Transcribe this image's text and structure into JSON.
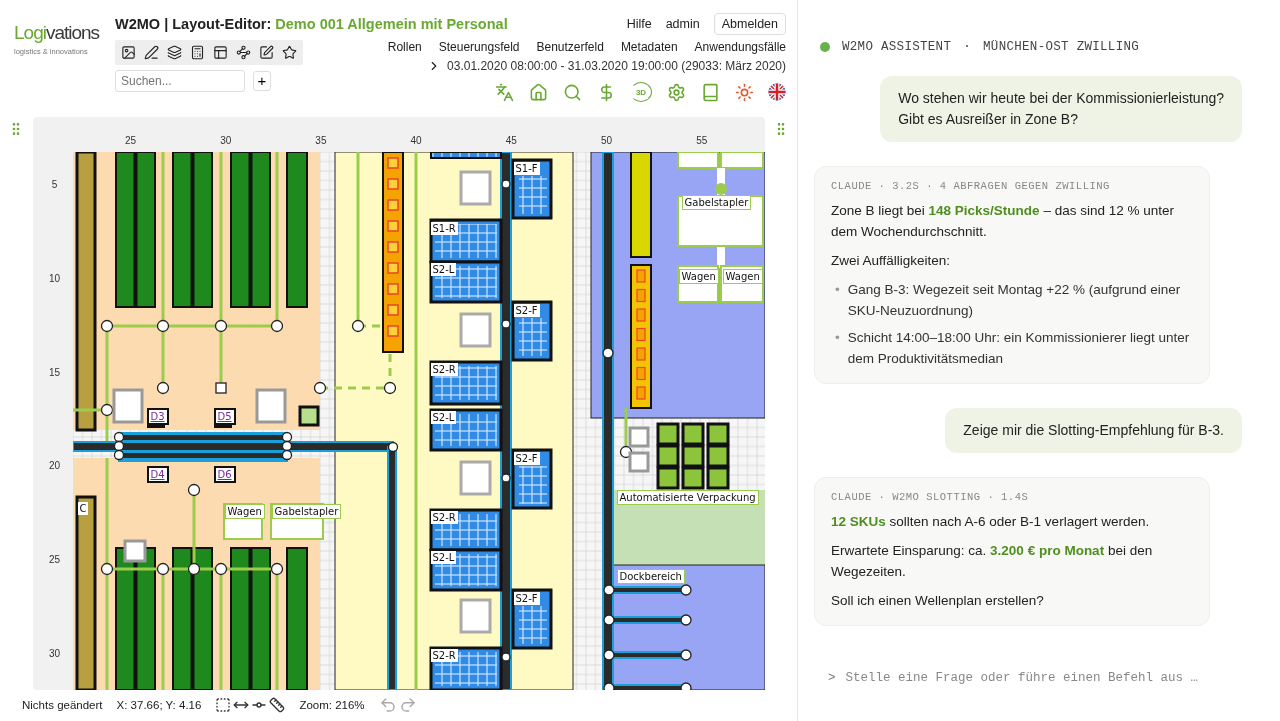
{
  "brand": {
    "name": "**Logi**vations",
    "tagline": "logistics & innovations"
  },
  "header": {
    "title": "W2MO | Layout-Editor: **Demo 001 Allgemein mit Personal**",
    "user_links": [
      "Hilfe",
      "admin"
    ],
    "logout_button": "Abmelden"
  },
  "nav_menu": [
    "Rollen",
    "Steuerungsfeld",
    "Benutzerfeld",
    "Metadaten",
    "Anwendungsfälle"
  ],
  "search": {
    "placeholder": "Suchen..."
  },
  "add_button": "+",
  "period": "03.01.2020 08:00:00 - 31.03.2020 19:00:00 (29033: März 2020)",
  "view_3d_label": "3D",
  "canvas": {
    "x_ticks": [
      "25",
      "30",
      "35",
      "40",
      "45",
      "50",
      "55"
    ],
    "y_ticks": [
      "5",
      "10",
      "15",
      "20",
      "25",
      "30"
    ],
    "labels": [
      {
        "text": "S1-F",
        "kind": "rack"
      },
      {
        "text": "S1-R",
        "kind": "rack"
      },
      {
        "text": "S2-L",
        "kind": "rack"
      },
      {
        "text": "S2-F",
        "kind": "rack"
      },
      {
        "text": "S2-R",
        "kind": "rack"
      },
      {
        "text": "S2-L",
        "kind": "rack"
      },
      {
        "text": "S2-F",
        "kind": "rack"
      },
      {
        "text": "S2-R",
        "kind": "rack"
      },
      {
        "text": "S2-L",
        "kind": "rack"
      },
      {
        "text": "S2-F",
        "kind": "rack"
      },
      {
        "text": "S2-R",
        "kind": "rack"
      },
      {
        "text": "D3",
        "kind": "dock"
      },
      {
        "text": "D5",
        "kind": "dock"
      },
      {
        "text": "D4",
        "kind": "dock"
      },
      {
        "text": "D6",
        "kind": "dock"
      },
      {
        "text": "C",
        "kind": "rack"
      },
      {
        "text": "Wagen",
        "kind": "area"
      },
      {
        "text": "Gabelstapler",
        "kind": "area"
      },
      {
        "text": "Gabelstapler",
        "kind": "area"
      },
      {
        "text": "Wagen",
        "kind": "area"
      },
      {
        "text": "Wagen",
        "kind": "area"
      },
      {
        "text": "Automatisierte Verpackung",
        "kind": "area"
      },
      {
        "text": "Dockbereich",
        "kind": "area"
      }
    ]
  },
  "status_bar": {
    "state": "Nichts geändert",
    "coordinates": "X: 37.66; Y: 4.16",
    "zoom": "Zoom: 216%"
  },
  "assistant": {
    "online": true,
    "title": "W2MO ASSISTENT",
    "separator": "·",
    "context": "MÜNCHEN-OST ZWILLING",
    "messages": [
      {
        "kind": "user",
        "text": "Wo stehen wir heute bei der Kommissionierleistung?\nGibt es Ausreißer in Zone B?"
      },
      {
        "kind": "assistant",
        "meta": "CLAUDE · 3.2S · 4 ABFRAGEN GEGEN ZWILLING",
        "blocks": [
          {
            "kind": "paragraph",
            "text": "Zone B liegt bei **148 Picks/Stunde** – das sind 12 % unter dem Wochendurchschnitt."
          },
          {
            "kind": "paragraph",
            "text": "Zwei Auffälligkeiten:"
          },
          {
            "kind": "bullets",
            "marker": "•",
            "items": [
              "Gang B-3: Wegezeit seit Montag +22 % (aufgrund einer SKU-Neuzuordnung)",
              "Schicht 14:00–18:00 Uhr: ein Kommissionierer liegt unter dem Produktivitätsmedian"
            ]
          }
        ]
      },
      {
        "kind": "user",
        "text": "Zeige mir die Slotting-Empfehlung für B-3."
      },
      {
        "kind": "assistant",
        "meta": "CLAUDE · W2MO SLOTTING · 1.4S",
        "blocks": [
          {
            "kind": "paragraph",
            "text": "**12 SKUs** sollten nach A-6 oder B-1 verlagert werden."
          },
          {
            "kind": "paragraph",
            "text": "Erwartete Einsparung: ca. **3.200 € pro Monat** bei den Wegezeiten."
          },
          {
            "kind": "paragraph",
            "text": "Soll ich einen Wellenplan erstellen?"
          }
        ]
      }
    ],
    "input": {
      "prompt": ">",
      "placeholder": "Stelle eine Frage oder führe einen Befehl aus …"
    }
  }
}
